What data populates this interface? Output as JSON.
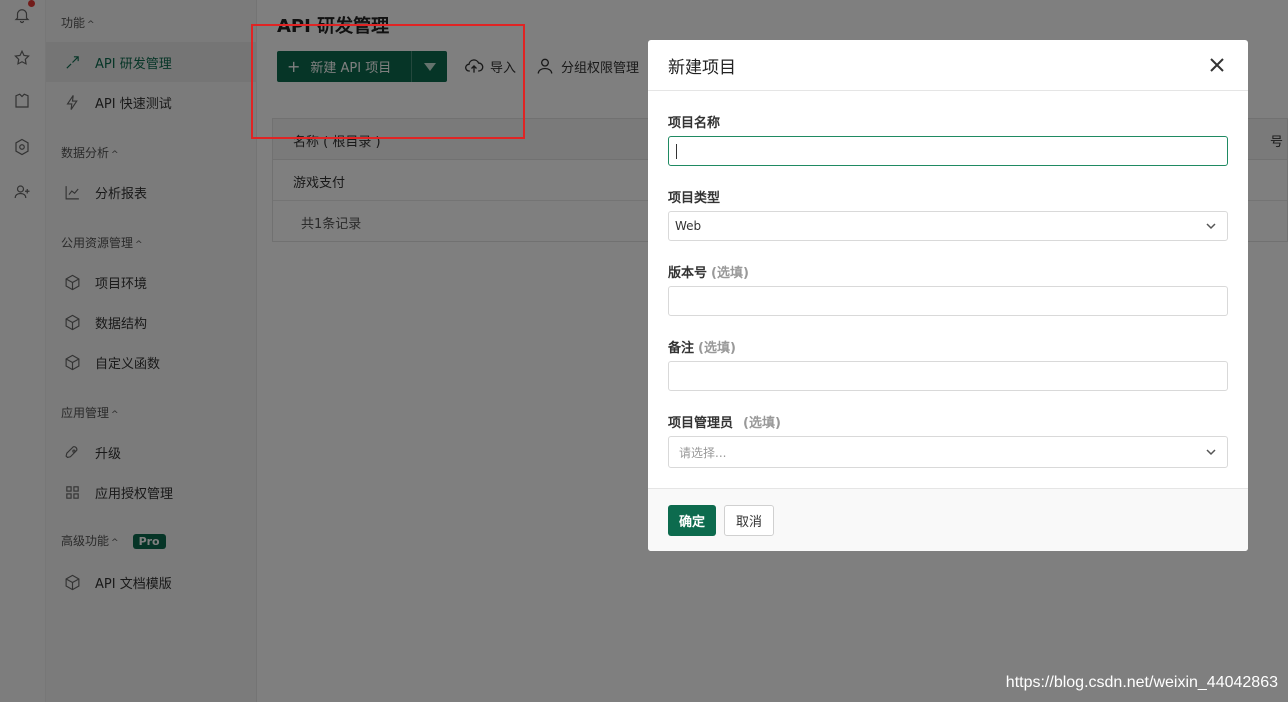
{
  "sidebar": {
    "groups": [
      {
        "title": "功能",
        "items": [
          {
            "label": "API 研发管理"
          },
          {
            "label": "API 快速测试"
          }
        ]
      },
      {
        "title": "数据分析",
        "items": [
          {
            "label": "分析报表"
          }
        ]
      },
      {
        "title": "公用资源管理",
        "items": [
          {
            "label": "项目环境"
          },
          {
            "label": "数据结构"
          },
          {
            "label": "自定义函数"
          }
        ]
      },
      {
        "title": "应用管理",
        "items": [
          {
            "label": "升级"
          },
          {
            "label": "应用授权管理"
          }
        ]
      },
      {
        "title": "高级功能",
        "badge": "Pro",
        "items": [
          {
            "label": "API 文档模版"
          }
        ]
      }
    ],
    "caret": "^"
  },
  "main": {
    "title": "API 研发管理",
    "new_button": "新建 API 项目",
    "import_label": "导入",
    "perm_label": "分组权限管理",
    "table": {
      "header": "名称 ( 根目录 )",
      "header_right": "号",
      "rows": [
        {
          "name": "游戏支付"
        }
      ],
      "footer": "共1条记录"
    }
  },
  "modal": {
    "title": "新建项目",
    "fields": {
      "name_label": "项目名称",
      "type_label": "项目类型",
      "type_value": "Web",
      "version_label": "版本号",
      "note_label": "备注",
      "admin_label": "项目管理员",
      "admin_placeholder": "请选择...",
      "optional": "(选填)"
    },
    "ok": "确定",
    "cancel": "取消"
  },
  "watermark": "https://blog.csdn.net/weixin_44042863",
  "colors": {
    "accent": "#0d6b4e",
    "highlight": "#e02424"
  }
}
